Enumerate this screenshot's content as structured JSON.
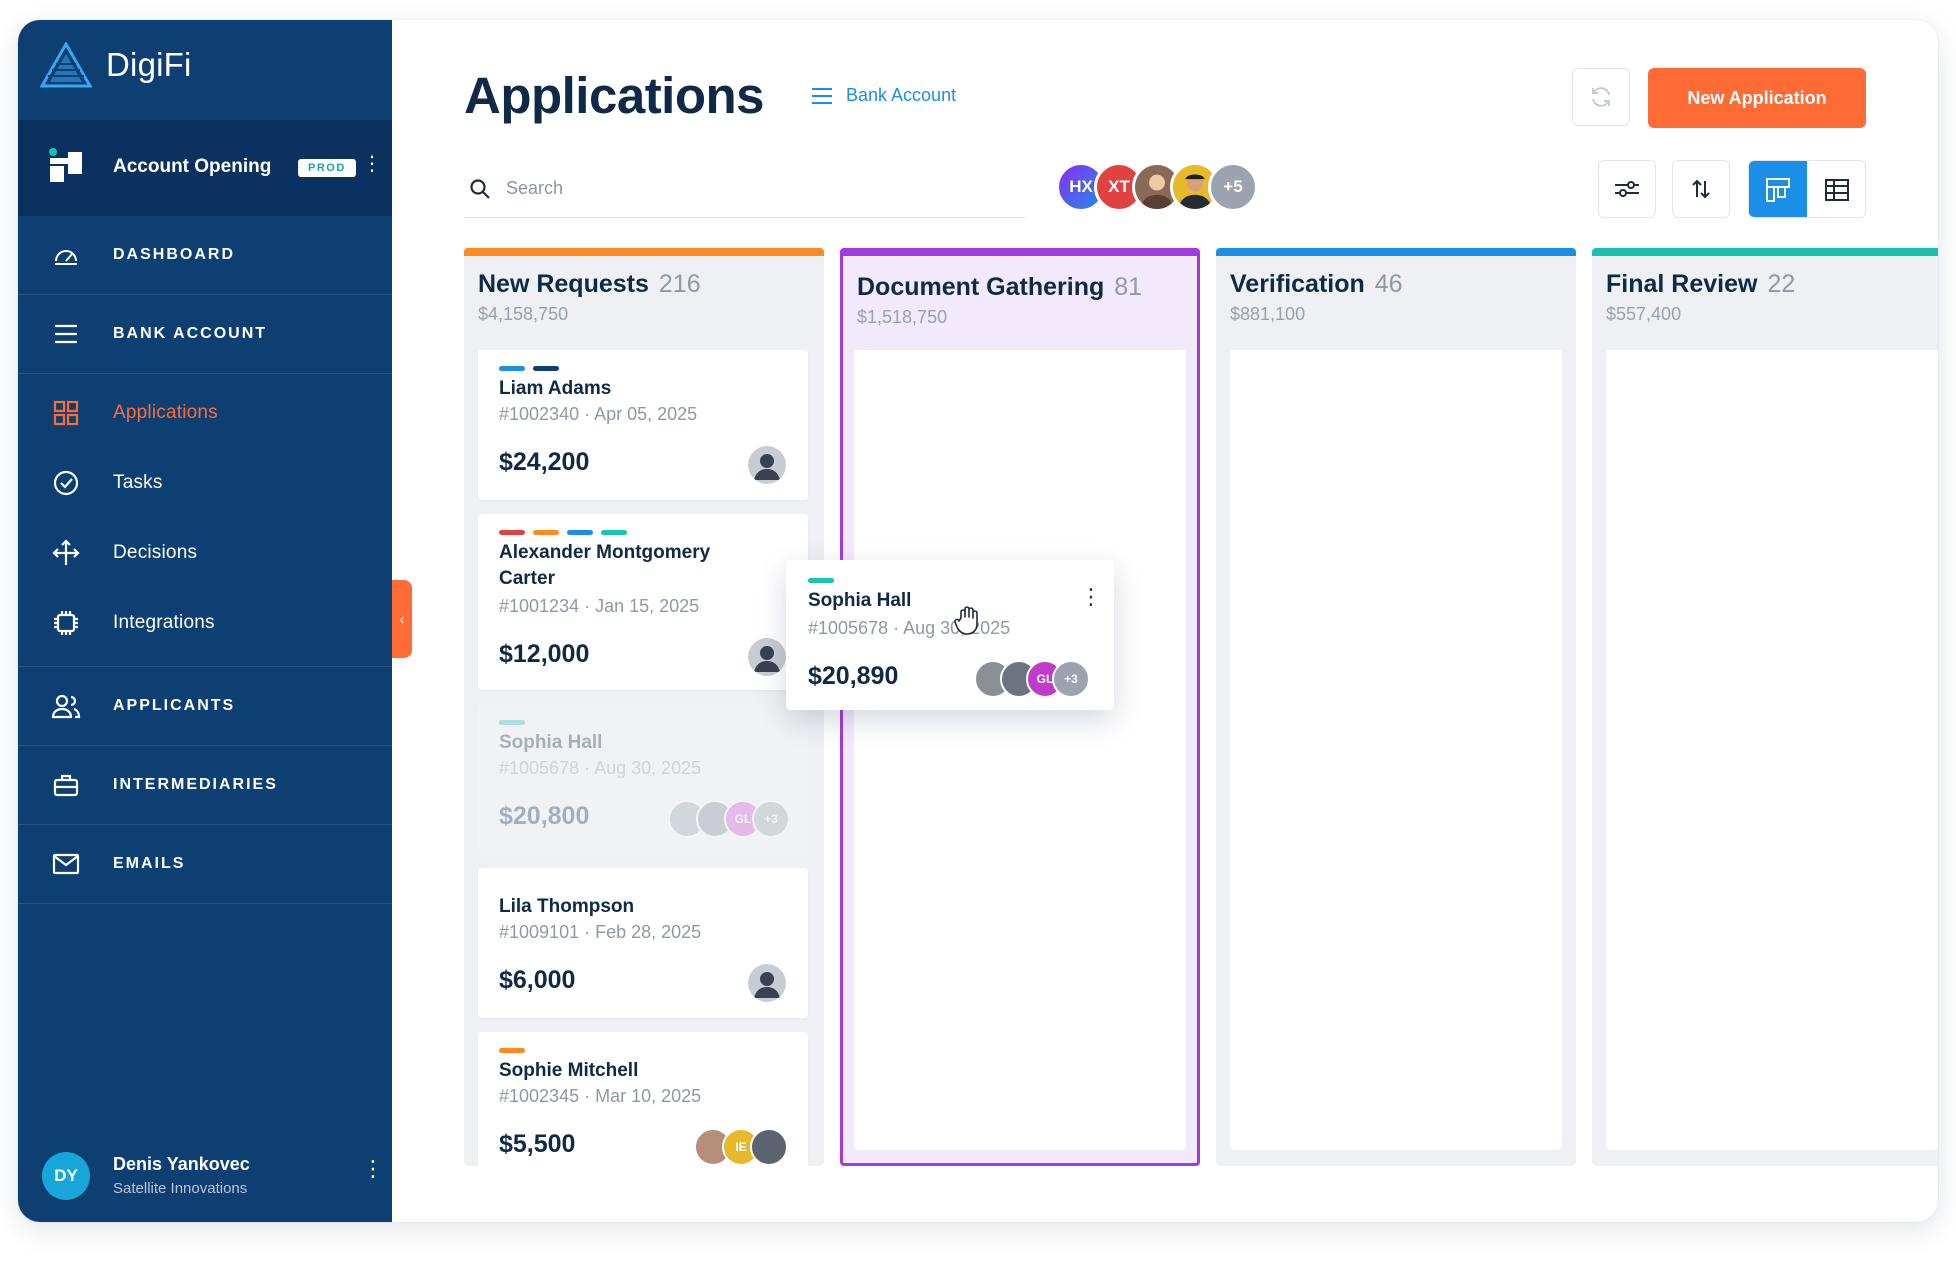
{
  "brand": {
    "name": "DigiFi"
  },
  "product": {
    "name": "Account Opening",
    "badge": "PROD"
  },
  "nav": {
    "dashboard": "DASHBOARD",
    "bank_account": "BANK ACCOUNT",
    "applications": "Applications",
    "tasks": "Tasks",
    "decisions": "Decisions",
    "integrations": "Integrations",
    "applicants": "APPLICANTS",
    "intermediaries": "INTERMEDIARIES",
    "emails": "EMAILS"
  },
  "user": {
    "initials": "DY",
    "name": "Denis Yankovec",
    "org": "Satellite Innovations"
  },
  "header": {
    "title": "Applications",
    "board": "Bank Account",
    "new_button": "New Application",
    "search_placeholder": "Search"
  },
  "team": {
    "avatars": [
      "HX",
      "XT"
    ],
    "more": "+5"
  },
  "columns": [
    {
      "title": "New Requests",
      "count": "216",
      "amount": "$4,158,750",
      "color": "#ff8a1f"
    },
    {
      "title": "Document Gathering",
      "count": "81",
      "amount": "$1,518,750",
      "color": "#a33ae0"
    },
    {
      "title": "Verification",
      "count": "46",
      "amount": "$881,100",
      "color": "#1b8ee8"
    },
    {
      "title": "Final Review",
      "count": "22",
      "amount": "$557,400",
      "color": "#19c2b0"
    }
  ],
  "cards": [
    {
      "name": "Liam Adams",
      "meta": "#1002340 · Apr 05, 2025",
      "amount": "$24,200"
    },
    {
      "name": "Alexander Montgomery Carter",
      "meta": "#1001234 · Jan 15, 2025",
      "amount": "$12,000"
    },
    {
      "name": "Sophia Hall",
      "meta": "#1005678 · Aug 30, 2025",
      "amount": "$20,800",
      "avatar_initials": "GL",
      "more": "+3"
    },
    {
      "name": "Lila Thompson",
      "meta": "#1009101 · Feb 28, 2025",
      "amount": "$6,000"
    },
    {
      "name": "Sophie Mitchell",
      "meta": "#1002345 · Mar 10, 2025",
      "amount": "$5,500",
      "avatar_initials": "IE"
    }
  ],
  "drag_card": {
    "name": "Sophia Hall",
    "meta": "#1005678 · Aug 30, 2025",
    "amount": "$20,890",
    "avatar_initials": "GL",
    "more": "+3"
  },
  "colors": {
    "sidebar": "#0e3f72",
    "accent": "#ff6b35",
    "primary": "#1b8ee8"
  }
}
